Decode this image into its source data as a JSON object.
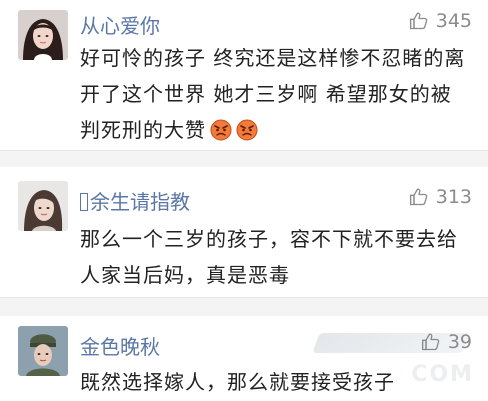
{
  "comments": [
    {
      "username": "从心爱你",
      "likes": "345",
      "text": "好可怜的孩子 终究还是这样惨不忍睹的离开了这个世界 她才三岁啊 希望那女的被判死刑的大赞",
      "emoji": "angry-face-icon"
    },
    {
      "username": "余生请指教",
      "likes": "313",
      "text": "那么一个三岁的孩子，容不下就不要去给人家当后妈，真是恶毒"
    },
    {
      "username": "金色晚秋",
      "likes": "39",
      "text": "既然选择嫁人，那么就要接受孩子"
    }
  ],
  "watermark": {
    "text": "COM"
  },
  "colors": {
    "username": "#5b77a6",
    "like": "#8b8b8b",
    "text": "#222222",
    "background": "#ffffff",
    "separator": "#e6e6e6"
  }
}
